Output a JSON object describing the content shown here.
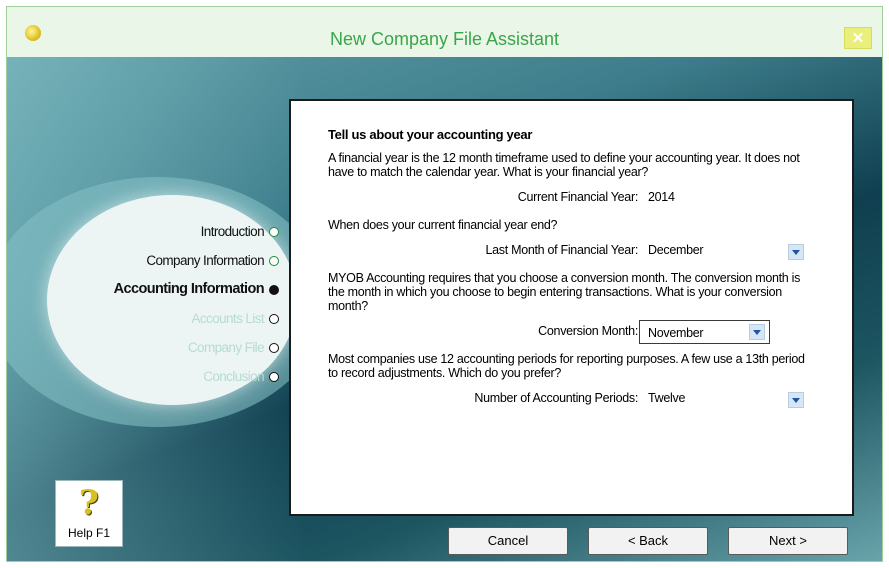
{
  "window": {
    "title": "New Company File Assistant",
    "close_glyph": "✕"
  },
  "steps": [
    {
      "label": "Introduction",
      "state": "done"
    },
    {
      "label": "Company Information",
      "state": "done"
    },
    {
      "label": "Accounting Information",
      "state": "current"
    },
    {
      "label": "Accounts List",
      "state": "future"
    },
    {
      "label": "Company File",
      "state": "future"
    },
    {
      "label": "Conclusion",
      "state": "future"
    }
  ],
  "help": {
    "icon": "?",
    "label": "Help F1"
  },
  "form": {
    "heading": "Tell us about your accounting year",
    "intro": "A financial year is the 12 month timeframe used to define your accounting year.  It does not have to match the calendar year.  What is your financial year?",
    "current_year_label": "Current Financial Year:",
    "current_year_value": "2014",
    "year_end_question": "When does your current financial year end?",
    "last_month_label": "Last Month of Financial Year:",
    "last_month_value": "December",
    "conversion_text": "MYOB Accounting requires that you choose a conversion month.  The conversion month is the month in which you choose to begin entering transactions.  What is your conversion month?",
    "conversion_label": "Conversion Month:",
    "conversion_value": "November",
    "periods_text": "Most companies use 12 accounting periods for reporting purposes.  A few use a 13th period to record adjustments.  Which do you prefer?",
    "periods_label": "Number of Accounting Periods:",
    "periods_value": "Twelve"
  },
  "buttons": {
    "cancel": "Cancel",
    "back": "< Back",
    "next": "Next >"
  }
}
